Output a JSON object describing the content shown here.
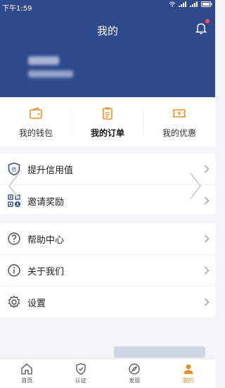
{
  "status": {
    "time": "下午1:59"
  },
  "header": {
    "title": "我的",
    "colors": {
      "bg": "#2f4a8c",
      "text": "#ffffff"
    }
  },
  "cards": [
    {
      "label": "我的钱包",
      "icon": "wallet-icon"
    },
    {
      "label": "我的订单",
      "icon": "order-icon"
    },
    {
      "label": "我的优惠",
      "icon": "coupon-icon"
    }
  ],
  "menu": {
    "group1": [
      {
        "label": "提升信用值",
        "icon": "credit-icon"
      },
      {
        "label": "邀请奖励",
        "icon": "invite-icon"
      }
    ],
    "group2": [
      {
        "label": "帮助中心",
        "icon": "help-icon"
      },
      {
        "label": "关于我们",
        "icon": "info-icon"
      },
      {
        "label": "设置",
        "icon": "settings-icon"
      }
    ]
  },
  "tabbar": [
    {
      "label": "首页",
      "icon": "home-icon",
      "active": false
    },
    {
      "label": "认证",
      "icon": "shield-icon",
      "active": false
    },
    {
      "label": "发现",
      "icon": "compass-icon",
      "active": false
    },
    {
      "label": "我的",
      "icon": "user-icon",
      "active": true
    }
  ],
  "accent": "#e9902a"
}
